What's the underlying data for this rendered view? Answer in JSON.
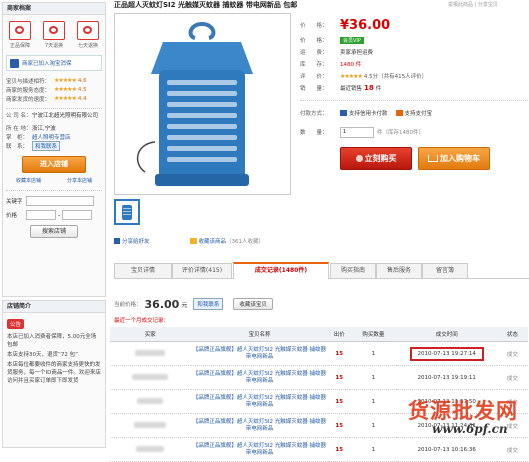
{
  "page_title": "正品超人灭蚊灯SI2 光触媒灭蚊器 捕蚊器 带电网新品 包邮",
  "top_right": "举报此商品 | 分享宝贝",
  "shop": {
    "header": "商家档案",
    "badges": [
      {
        "label": "正品保障",
        "icon": "shield-icon"
      },
      {
        "label": "7天退换",
        "icon": "return-icon"
      },
      {
        "label": "七天退换",
        "icon": "refund-icon"
      }
    ],
    "join_label": "商家已加入淘宝消保",
    "ratings": [
      {
        "label": "宝贝与描述相符：",
        "score": "4.6"
      },
      {
        "label": "商家的服务态度：",
        "score": "4.5"
      },
      {
        "label": "商家发货的速度：",
        "score": "4.4"
      }
    ],
    "company_key": "公 司 名：",
    "company_val": "宁波江北超光照明有限公司",
    "location_key": "所 在 地：",
    "location_val": "浙江,宁波",
    "seller_key": "掌　柜：",
    "seller_val": "超人照明专营店",
    "contact_key": "联　系：",
    "contact_val": "和我联系",
    "enter_shop": "进入店铺",
    "collect_shop": "收藏本店铺",
    "share_shop": "分享本店铺",
    "keyword_label": "关键字",
    "price_label": "价格",
    "search_btn": "搜索店铺"
  },
  "shop_intro": {
    "header": "店铺简介",
    "badge": "公告",
    "lines": [
      "本店已加入消费者保障，5.00元全场包邮",
      "本店支持30天，退货“72 包”",
      "本店每位都要收件的商家支持更快的发货服务，每一个ID商品一件。欢迎来店访问并且买家订单即下即发货"
    ]
  },
  "product": {
    "price_label": "价　　格：",
    "price": "¥36.00",
    "vip_label": "价　　格：",
    "vip_tag": "会员VIP",
    "promo_label": "运　　费：",
    "promo_val": "卖家承担运费",
    "stock_label": "库　　存：",
    "stock_val": "1480 件",
    "rating_label": "评　　价：",
    "rating_val": "4.5分（共有415人评价）",
    "sold_label": "销　　量：",
    "sold_val": "最近销售",
    "sold_num": "18",
    "sold_unit": "件",
    "pay_label": "付款方式：",
    "pay_1": "支持信用卡付款",
    "pay_2": "支持支付宝",
    "qty_label": "数　　量：",
    "qty": "1",
    "qty_stock": "件（库存1480件）",
    "buy_now": "立刻购买",
    "add_cart": "加入购物车",
    "share": "分享给好友",
    "collect": "收藏该商品",
    "collect_count": "（361人收藏）"
  },
  "tabs": [
    {
      "label": "宝贝详情"
    },
    {
      "label": "评价详情(415)"
    },
    {
      "label": "成交记录(1480件)"
    },
    {
      "label": "购买指南"
    },
    {
      "label": "售后服务"
    },
    {
      "label": "留言簿"
    }
  ],
  "records": {
    "now_price_label": "当前价格：",
    "now_price": "36.00",
    "now_price_unit": "元",
    "alipay_badge": "和我联系",
    "collect_btn": "收藏该宝贝",
    "summary": "最近一个月成交记录：",
    "columns": [
      "买家",
      "宝贝名称",
      "出价",
      "购买数量",
      "成交时间",
      "状态"
    ],
    "rows": [
      {
        "item": "【品牌正品旗舰】超人灭蚊灯SI2 光触媒灭蚊器 捕蚊器 带电网新品",
        "price": "15",
        "qty": "1",
        "time": "2010-07-13 19:27:14",
        "status": "成交"
      },
      {
        "item": "【品牌正品旗舰】超人灭蚊灯SI2 光触媒灭蚊器 捕蚊器 带电网新品",
        "price": "15",
        "qty": "1",
        "time": "2010-07-13 19:19:11",
        "status": "成交"
      },
      {
        "item": "【品牌正品旗舰】超人灭蚊灯SI2 光触媒灭蚊器 捕蚊器 带电网新品",
        "price": "15",
        "qty": "1",
        "time": "2010-07-13 11:57:50",
        "status": "成交"
      },
      {
        "item": "【品牌正品旗舰】超人灭蚊灯SI2 光触媒灭蚊器 捕蚊器 带电网新品",
        "price": "15",
        "qty": "1",
        "time": "2010-07-13 11:24:31",
        "status": "成交"
      },
      {
        "item": "【品牌正品旗舰】超人灭蚊灯SI2 光触媒灭蚊器 捕蚊器 带电网新品",
        "price": "15",
        "qty": "1",
        "time": "2010-07-13 10:16:36",
        "status": "成交"
      }
    ]
  },
  "watermark": {
    "line1": "货源批发网",
    "line2": "www.6pf.cn"
  },
  "colors": {
    "accent": "#e8630a",
    "price": "#d00000",
    "link": "#245ca8",
    "highlight_box": "#cc2222"
  }
}
